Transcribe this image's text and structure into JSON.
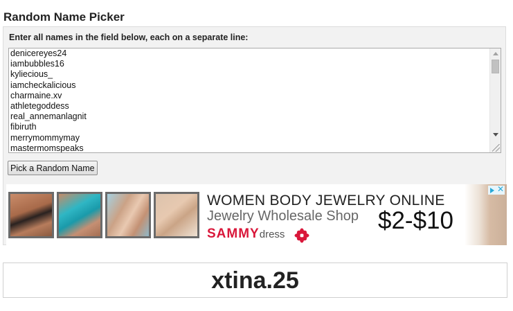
{
  "page": {
    "title": "Random Name Picker"
  },
  "form": {
    "instructions": "Enter all names in the field below, each on a separate line:",
    "names": [
      "denicereyes24",
      "iambubbles16",
      "kyliecious_",
      "iamcheckalicious",
      "charmaine.xv",
      "athletegoddess",
      "real_annemanlagnit",
      "fibiruth",
      "merrymommymay",
      "mastermomspeaks"
    ],
    "button_label": "Pick a Random Name"
  },
  "ad": {
    "headline": "WOMEN BODY JEWELRY ONLINE",
    "subheadline": "Jewelry Wholesale Shop",
    "brand_main": "SAMMY",
    "brand_suffix": "dress",
    "price": "$2-$10",
    "brand_color": "#d9173a"
  },
  "result": {
    "name": "xtina.25"
  },
  "icons": [
    "scroll-up-arrow-icon",
    "scroll-down-arrow-icon",
    "resize-grip-icon",
    "flower-logo-icon",
    "adchoices-icon"
  ]
}
